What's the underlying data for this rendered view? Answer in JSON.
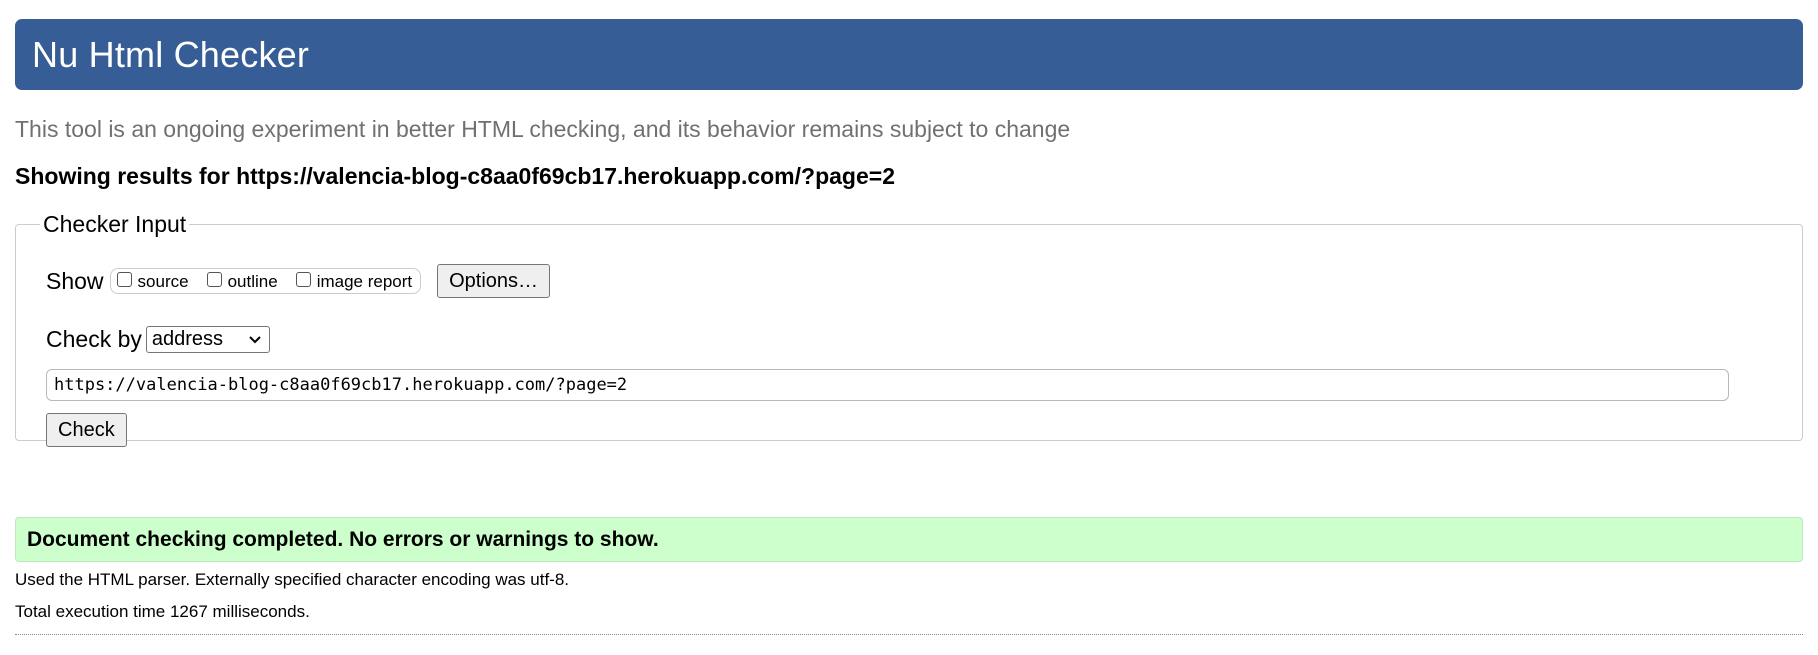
{
  "header": {
    "title": "Nu Html Checker"
  },
  "subtitle": "This tool is an ongoing experiment in better HTML checking, and its behavior remains subject to change",
  "results": {
    "prefix": "Showing results for ",
    "url": "https://valencia-blog-c8aa0f69cb17.herokuapp.com/?page=2"
  },
  "checker_input": {
    "legend": "Checker Input",
    "show_label": "Show",
    "show_options": [
      {
        "label": "source",
        "checked": false
      },
      {
        "label": "outline",
        "checked": false
      },
      {
        "label": "image report",
        "checked": false
      }
    ],
    "options_button": "Options…",
    "check_by_label": "Check by",
    "check_by_selected": "address",
    "url_value": "https://valencia-blog-c8aa0f69cb17.herokuapp.com/?page=2",
    "check_button": "Check"
  },
  "result_message": "Document checking completed. No errors or warnings to show.",
  "parser_note": "Used the HTML parser. Externally specified character encoding was utf-8.",
  "execution_time": "Total execution time 1267 milliseconds.",
  "colors": {
    "header_bg": "#365d95",
    "success_bg": "#ccffcc",
    "subtitle_text": "#707070"
  },
  "icons": {
    "select_arrow": "chevron-down-icon",
    "checkbox": "checkbox-icon"
  }
}
